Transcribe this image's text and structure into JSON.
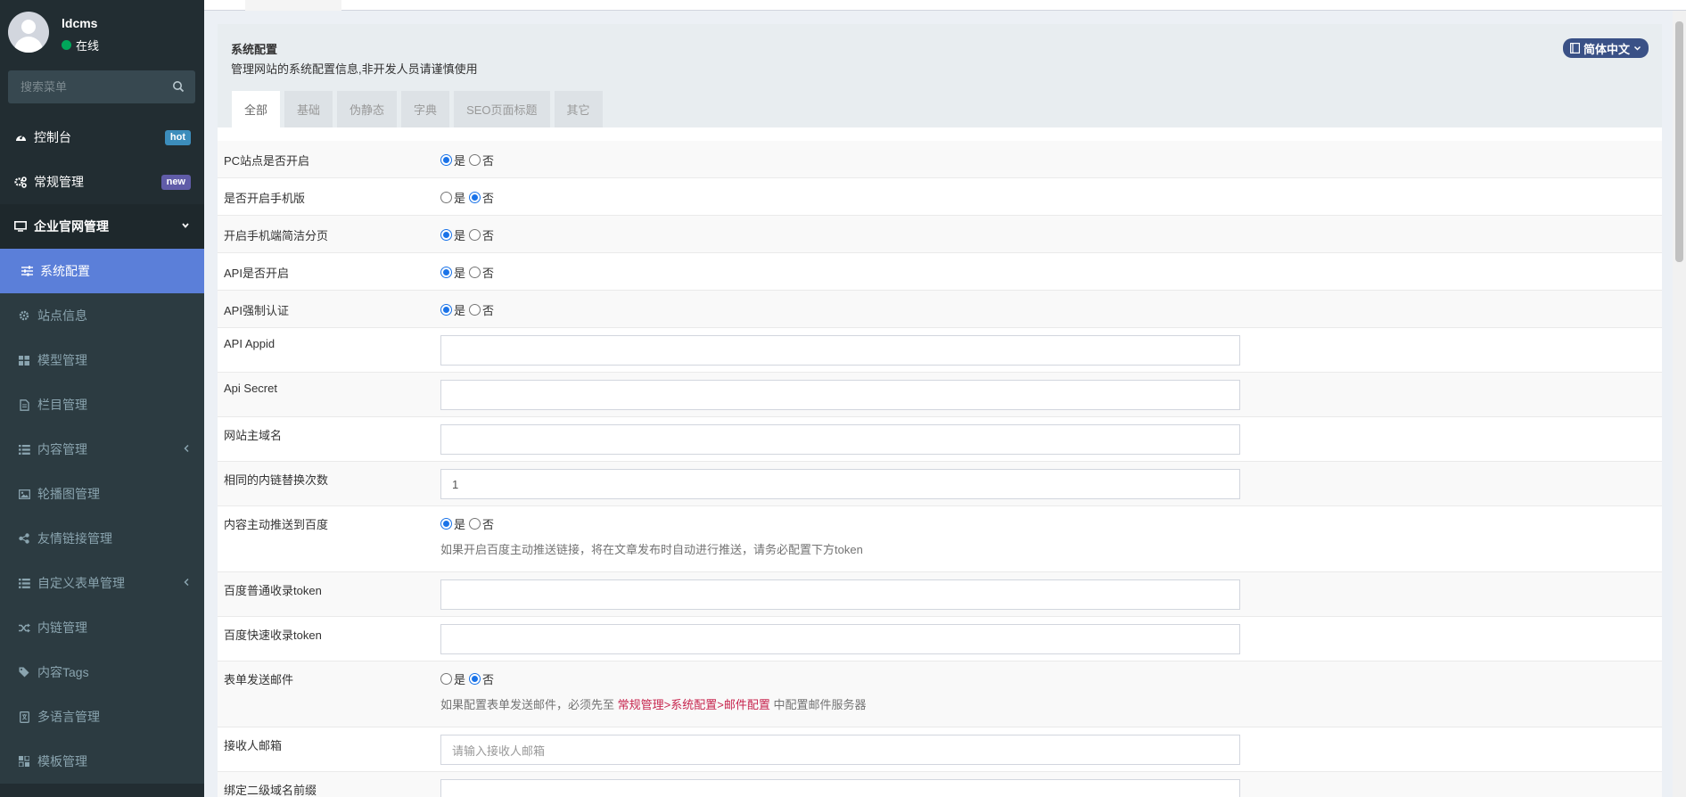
{
  "user": {
    "name": "ldcms",
    "status": "在线"
  },
  "search": {
    "placeholder": "搜索菜单"
  },
  "menu": {
    "dashboard": {
      "label": "控制台",
      "badge": "hot"
    },
    "general": {
      "label": "常规管理",
      "badge": "new"
    },
    "enterprise": {
      "label": "企业官网管理"
    },
    "sub": [
      {
        "label": "系统配置",
        "icon": "sliders-icon"
      },
      {
        "label": "站点信息",
        "icon": "gear-icon"
      },
      {
        "label": "模型管理",
        "icon": "grid-icon"
      },
      {
        "label": "栏目管理",
        "icon": "document-icon"
      },
      {
        "label": "内容管理",
        "icon": "list-icon"
      },
      {
        "label": "轮播图管理",
        "icon": "image-icon"
      },
      {
        "label": "友情链接管理",
        "icon": "share-icon"
      },
      {
        "label": "自定义表单管理",
        "icon": "list-icon"
      },
      {
        "label": "内链管理",
        "icon": "random-icon"
      },
      {
        "label": "内容Tags",
        "icon": "tags-icon"
      },
      {
        "label": "多语言管理",
        "icon": "language-icon"
      },
      {
        "label": "模板管理",
        "icon": "template-icon"
      }
    ]
  },
  "panel": {
    "title": "系统配置",
    "description": "管理网站的系统配置信息,非开发人员请谨慎使用",
    "language": "简体中文"
  },
  "tabs": [
    "全部",
    "基础",
    "伪静态",
    "字典",
    "SEO页面标题",
    "其它"
  ],
  "radio": {
    "yes": "是",
    "no": "否"
  },
  "form": {
    "pc_site": {
      "label": "PC站点是否开启",
      "value": "是"
    },
    "mobile": {
      "label": "是否开启手机版",
      "value": "否"
    },
    "mobile_paging": {
      "label": "开启手机端简洁分页",
      "value": "是"
    },
    "api_enabled": {
      "label": "API是否开启",
      "value": "是"
    },
    "api_auth": {
      "label": "API强制认证",
      "value": "是"
    },
    "api_appid": {
      "label": "API Appid",
      "value": ""
    },
    "api_secret": {
      "label": "Api Secret",
      "value": ""
    },
    "main_domain": {
      "label": "网站主域名",
      "value": ""
    },
    "link_replace": {
      "label": "相同的内链替换次数",
      "value": "1"
    },
    "baidu_push": {
      "label": "内容主动推送到百度",
      "value": "是",
      "help": "如果开启百度主动推送链接，将在文章发布时自动进行推送，请务必配置下方token"
    },
    "baidu_normal_token": {
      "label": "百度普通收录token",
      "value": ""
    },
    "baidu_fast_token": {
      "label": "百度快速收录token",
      "value": ""
    },
    "form_mail": {
      "label": "表单发送邮件",
      "value": "否",
      "help_prefix": "如果配置表单发送邮件，必须先至",
      "help_link": "常规管理>系统配置>邮件配置",
      "help_suffix": "中配置邮件服务器"
    },
    "receiver_email": {
      "label": "接收人邮箱",
      "placeholder": "请输入接收人邮箱"
    },
    "subdomain_prefix": {
      "label": "绑定二级域名前缀"
    }
  }
}
